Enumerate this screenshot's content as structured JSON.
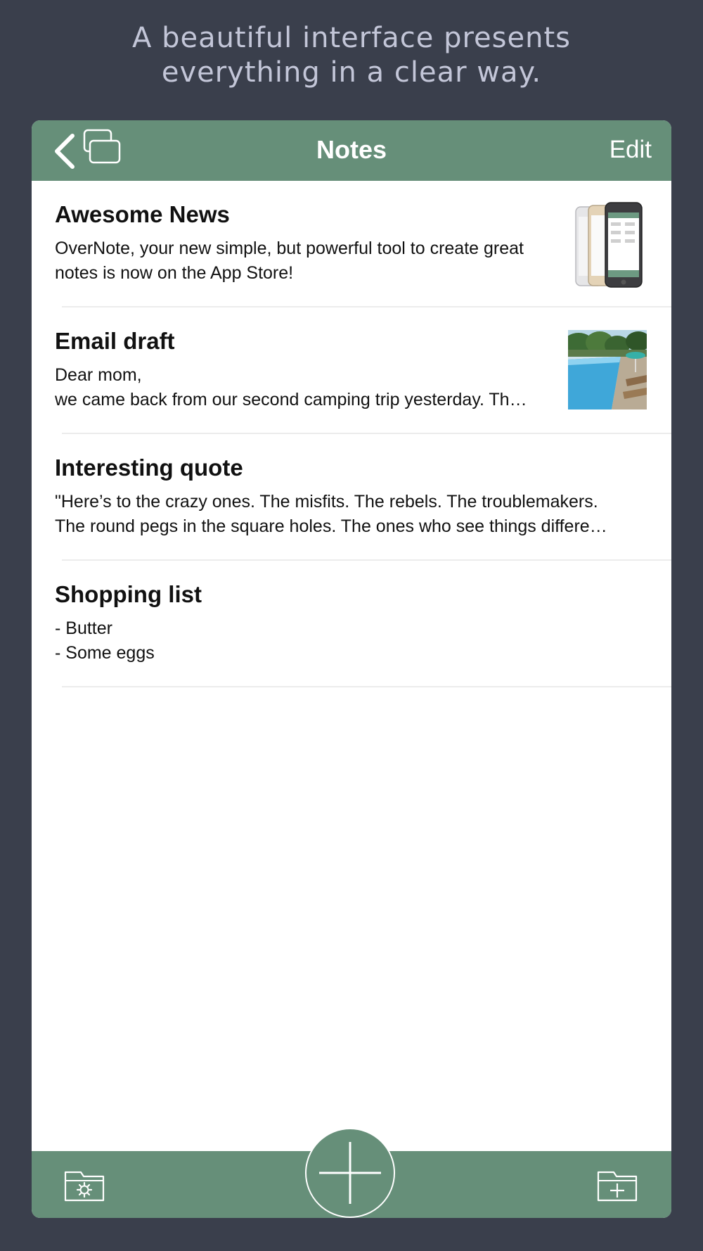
{
  "promo": {
    "line1": "A beautiful interface presents",
    "line2": "everything in a clear way."
  },
  "navbar": {
    "title": "Notes",
    "edit_label": "Edit",
    "back_icon": "chevron-left-icon",
    "windows_icon": "stacked-windows-icon"
  },
  "notes": [
    {
      "title": "Awesome News",
      "lines": [
        "OverNote, your new simple, but powerful tool to create great",
        "notes is now on the App Store!"
      ],
      "thumbnail": "phones-image"
    },
    {
      "title": "Email draft",
      "lines": [
        "Dear mom,",
        "we came back from our second camping trip yesterday. Th…"
      ],
      "thumbnail": "pool-image"
    },
    {
      "title": "Interesting quote",
      "lines": [
        "\"Here’s to the crazy ones. The misfits. The rebels. The troublemakers.",
        "The round pegs in the square holes. The ones who see things differe…"
      ]
    },
    {
      "title": "Shopping list",
      "lines": [
        "- Butter",
        "- Some eggs"
      ]
    }
  ],
  "toolbar": {
    "left_icon": "folder-settings-icon",
    "center_icon": "plus-icon",
    "right_icon": "folder-add-icon"
  },
  "colors": {
    "background": "#3a3f4c",
    "accent": "#668f79",
    "promo_text": "#c3c6d8"
  }
}
